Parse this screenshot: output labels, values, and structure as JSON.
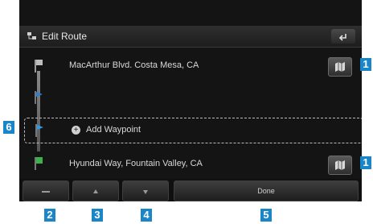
{
  "header": {
    "title": "Edit Route",
    "icon": "route-edit-icon",
    "back_icon": "back-arrow-icon"
  },
  "route": {
    "start": {
      "label": "MacArthur Blvd. Costa Mesa, CA",
      "marker": "start-flag-icon"
    },
    "add_waypoint": {
      "label": "Add Waypoint",
      "icon": "add-circle-icon"
    },
    "destination": {
      "label": "Hyundai Way, Fountain Valley, CA",
      "marker": "destination-flag-icon"
    }
  },
  "bottom_bar": {
    "done_label": "Done"
  },
  "callouts": [
    "1",
    "1",
    "2",
    "3",
    "4",
    "5",
    "6"
  ],
  "colors": {
    "callout": "#1a86c8",
    "screen_bg": "#141414"
  }
}
